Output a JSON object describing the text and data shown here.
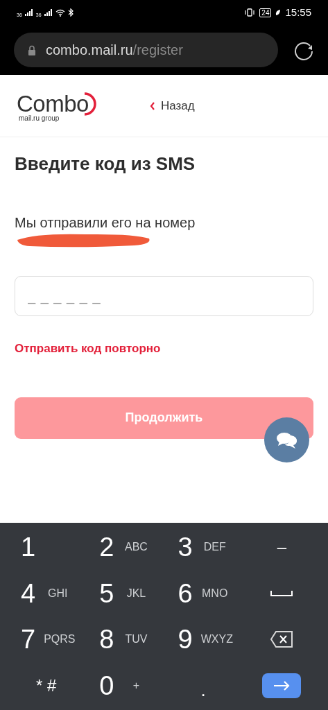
{
  "status_bar": {
    "sim_1": "36",
    "sim_2": "36",
    "battery": "24",
    "time": "15:55"
  },
  "browser": {
    "url_host": "combo.mail.ru",
    "url_path": "/register"
  },
  "header": {
    "logo": "Combo",
    "logo_subtitle": "mail.ru group",
    "back_link": "Назад"
  },
  "title": "Введите код из SMS",
  "message": "Мы отправили его на номер",
  "code_field": {
    "placeholder": "_ _ _ _ _ _"
  },
  "resend_link": "Отправить код повторно",
  "continue_button": {
    "label": "Продолжить",
    "disabled": true
  },
  "keyboard": {
    "keys": [
      {
        "kind": "digit",
        "label": "1"
      },
      {
        "kind": "digit",
        "label": "2",
        "letters": "ABC"
      },
      {
        "kind": "digit",
        "label": "3",
        "letters": "DEF"
      },
      {
        "kind": "symbol",
        "label": "–"
      },
      {
        "kind": "digit",
        "label": "4",
        "letters": "GHI"
      },
      {
        "kind": "digit",
        "label": "5",
        "letters": "JKL"
      },
      {
        "kind": "digit",
        "label": "6",
        "letters": "MNO"
      },
      {
        "kind": "space"
      },
      {
        "kind": "digit",
        "label": "7",
        "letters": "PQRS"
      },
      {
        "kind": "digit",
        "label": "8",
        "letters": "TUV"
      },
      {
        "kind": "digit",
        "label": "9",
        "letters": "WXYZ"
      },
      {
        "kind": "backspace"
      },
      {
        "kind": "symbol",
        "label": "* #"
      },
      {
        "kind": "digit",
        "label": "0",
        "letters": "+"
      },
      {
        "kind": "dot",
        "label": "."
      },
      {
        "kind": "enter"
      }
    ]
  }
}
